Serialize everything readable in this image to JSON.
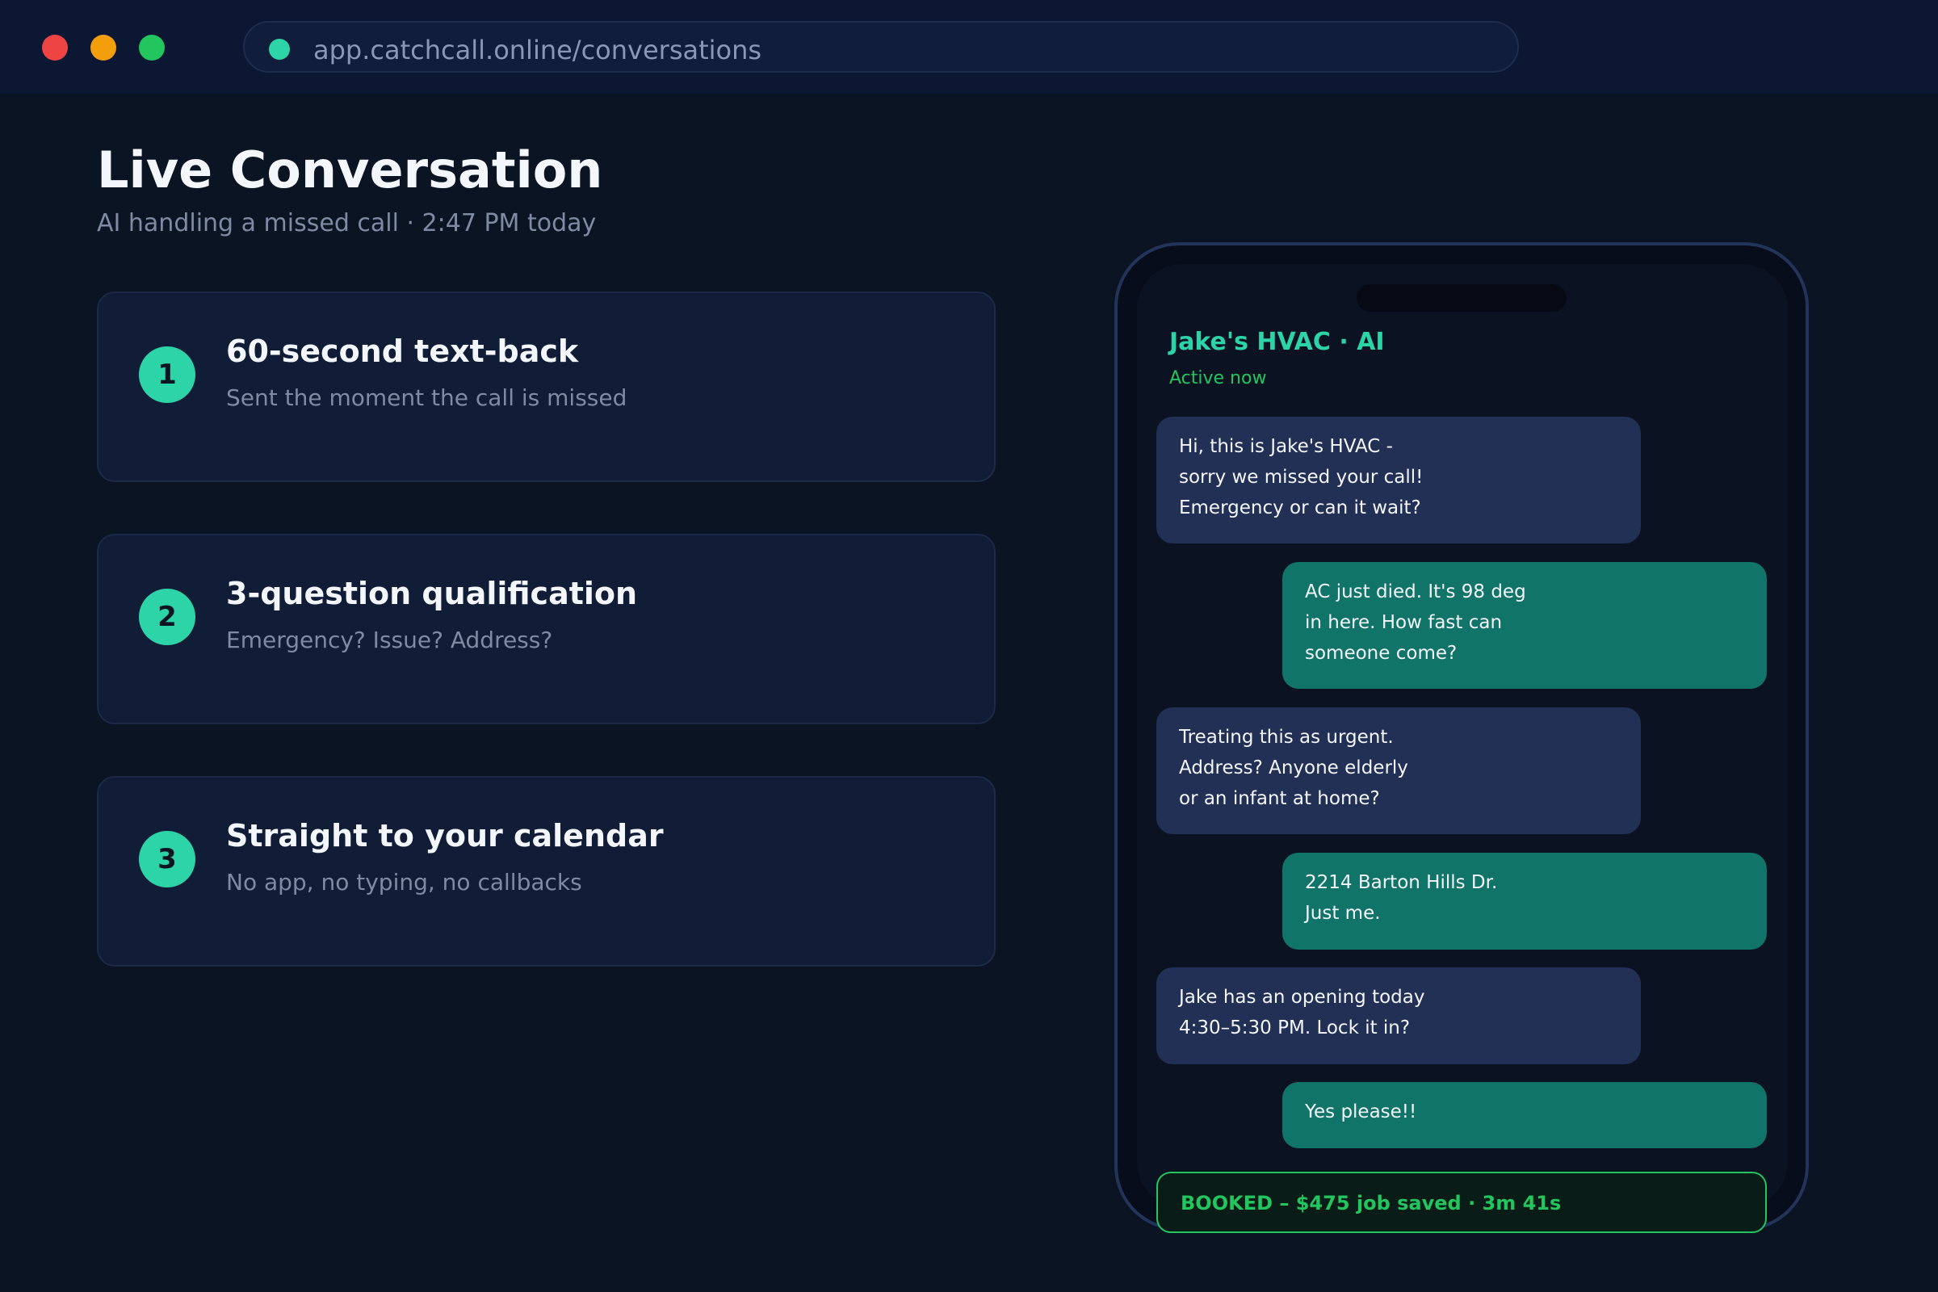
{
  "browser": {
    "url": "app.catchcall.online/conversations",
    "status_color": "#2dd4a7"
  },
  "page": {
    "title": "Live Conversation",
    "subtitle": "AI handling a missed call  ·  2:47 PM today"
  },
  "steps": [
    {
      "number": "1",
      "title": "60-second text-back",
      "description": "Sent the moment the call is missed"
    },
    {
      "number": "2",
      "title": "3-question qualification",
      "description": "Emergency? Issue? Address?"
    },
    {
      "number": "3",
      "title": "Straight to your calendar",
      "description": "No app, no typing, no callbacks"
    }
  ],
  "conversation": {
    "contact_name": "Jake's HVAC  ·  AI",
    "contact_status": "Active now",
    "messages": [
      {
        "sender": "ai",
        "text": "Hi, this is Jake's HVAC -\nsorry we missed your call!\nEmergency or can it wait?"
      },
      {
        "sender": "customer",
        "text": "AC just died. It's 98 deg\nin here. How fast can\nsomeone come?"
      },
      {
        "sender": "ai",
        "text": "Treating this as urgent.\nAddress? Anyone elderly\nor an infant at home?"
      },
      {
        "sender": "customer",
        "text": "2214 Barton Hills Dr.\nJust me."
      },
      {
        "sender": "ai",
        "text": "Jake has an opening today\n4:30–5:30 PM. Lock it in?"
      },
      {
        "sender": "customer",
        "text": "Yes please!!"
      }
    ],
    "booked_banner": "BOOKED – $475 job saved  ·  3m 41s"
  },
  "colors": {
    "accent": "#2dd4a7",
    "success": "#22c55e",
    "ai_bubble": "#213054",
    "customer_bubble": "#117468"
  }
}
